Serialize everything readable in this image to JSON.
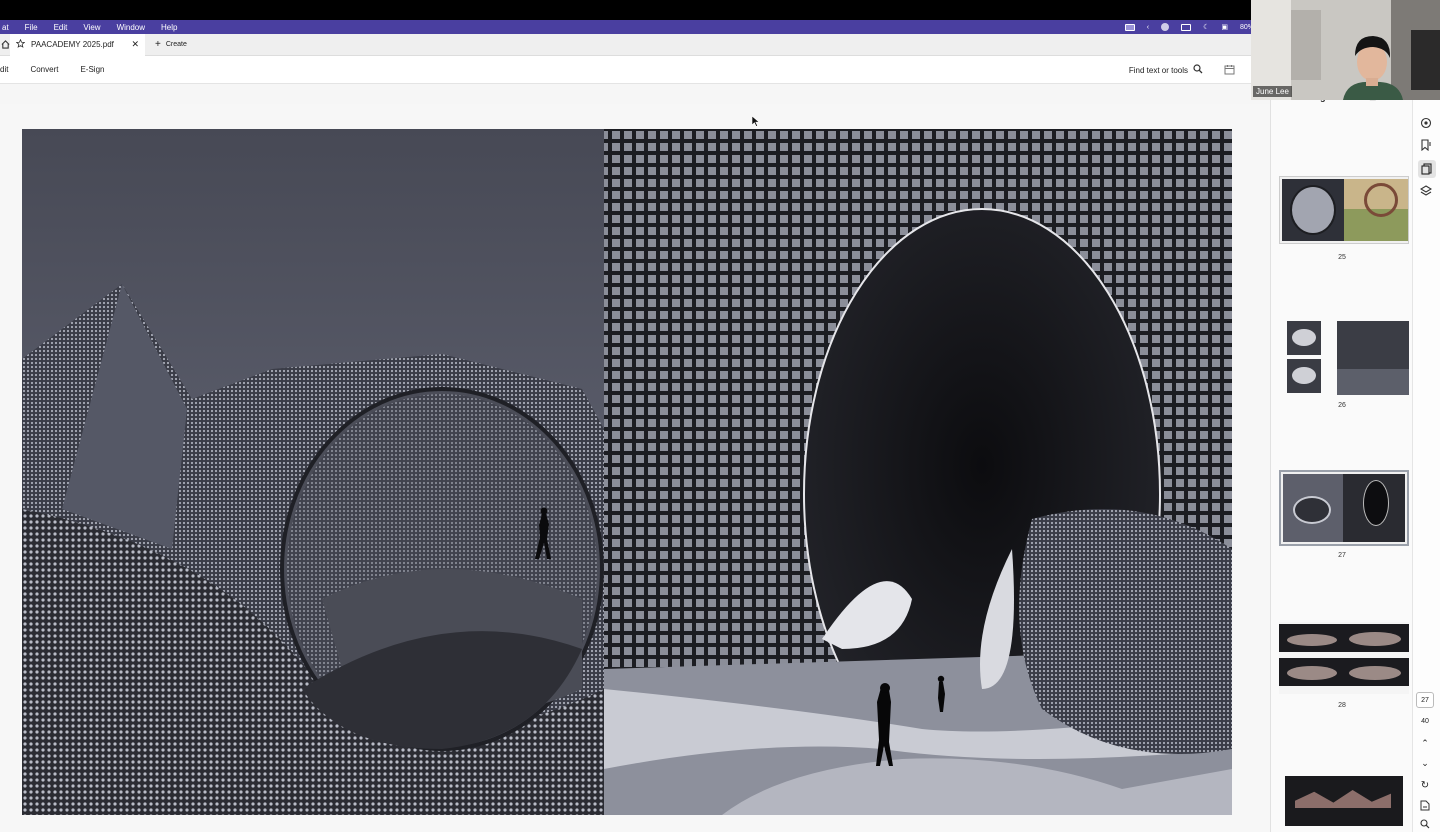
{
  "menubar": {
    "items": [
      "at",
      "File",
      "Edit",
      "View",
      "Window",
      "Help"
    ],
    "battery": "80%"
  },
  "tabbar": {
    "tab_title": "PAACADEMY 2025.pdf",
    "create_label": "Create"
  },
  "toolbar": {
    "items": [
      "dit",
      "Convert",
      "E-Sign"
    ],
    "find_label": "Find text or tools"
  },
  "panel": {
    "title": "Pages",
    "thumbnails": [
      {
        "label": "25"
      },
      {
        "label": "26"
      },
      {
        "label": "27"
      },
      {
        "label": "28"
      }
    ]
  },
  "page_nav": {
    "current_page": "27",
    "total_pages": "40"
  },
  "webcam": {
    "name": "June Lee"
  },
  "colors": {
    "menubar": "#4a3fa0",
    "artwork_bg": "#5b5d6a"
  }
}
